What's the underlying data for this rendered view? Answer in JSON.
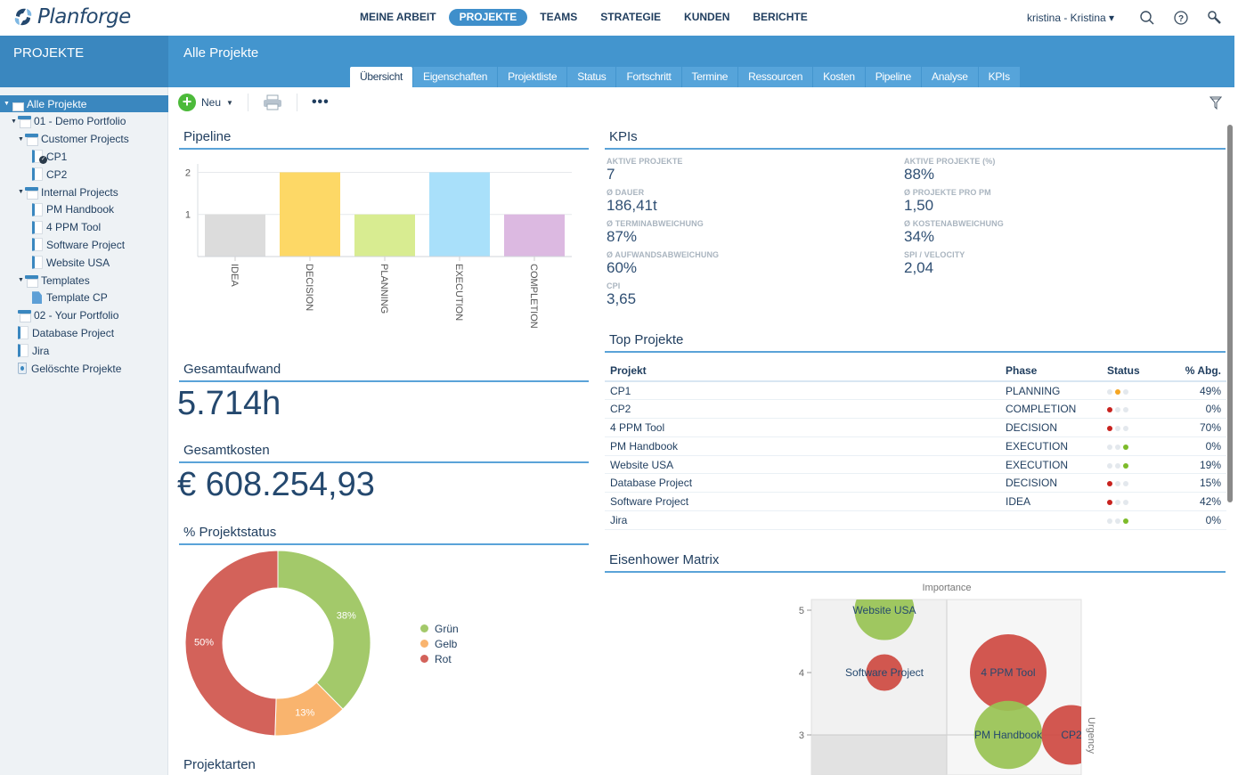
{
  "app": {
    "brand": "Planforge"
  },
  "nav": {
    "items": [
      "MEINE ARBEIT",
      "PROJEKTE",
      "TEAMS",
      "STRATEGIE",
      "KUNDEN",
      "BERICHTE"
    ],
    "active": "PROJEKTE",
    "user": "kristina - Kristina ▾"
  },
  "module_title": "PROJEKTE",
  "page_title": "Alle Projekte",
  "tabs": [
    "Übersicht",
    "Eigenschaften",
    "Projektliste",
    "Status",
    "Fortschritt",
    "Termine",
    "Ressourcen",
    "Kosten",
    "Pipeline",
    "Analyse",
    "KPIs"
  ],
  "active_tab": "Übersicht",
  "toolbar": {
    "new_label": "Neu",
    "more_label": "•••"
  },
  "tree": [
    {
      "label": "Alle Projekte",
      "level": 0,
      "icon": "folder",
      "caret": true,
      "selected": true
    },
    {
      "label": "01 - Demo Portfolio",
      "level": 1,
      "icon": "folder",
      "caret": true
    },
    {
      "label": "Customer Projects",
      "level": 2,
      "icon": "folder",
      "caret": true
    },
    {
      "label": "CP1",
      "level": 3,
      "icon": "project-checked"
    },
    {
      "label": "CP2",
      "level": 3,
      "icon": "project"
    },
    {
      "label": "Internal Projects",
      "level": 2,
      "icon": "folder",
      "caret": true
    },
    {
      "label": "PM Handbook",
      "level": 3,
      "icon": "project"
    },
    {
      "label": "4 PPM Tool",
      "level": 3,
      "icon": "project"
    },
    {
      "label": "Software Project",
      "level": 3,
      "icon": "project"
    },
    {
      "label": "Website USA",
      "level": 3,
      "icon": "project"
    },
    {
      "label": "Templates",
      "level": 2,
      "icon": "folder",
      "caret": true
    },
    {
      "label": "Template CP",
      "level": 3,
      "icon": "template"
    },
    {
      "label": "02 - Your Portfolio",
      "level": 1,
      "icon": "folder"
    },
    {
      "label": "Database Project",
      "level": 1,
      "icon": "project"
    },
    {
      "label": "Jira",
      "level": 1,
      "icon": "project"
    },
    {
      "label": "Gelöschte Projekte",
      "level": 1,
      "icon": "trash"
    }
  ],
  "sections": {
    "pipeline": "Pipeline",
    "kpis": "KPIs",
    "gesamtaufwand": "Gesamtaufwand",
    "gesamtaufwand_value": "5.714h",
    "gesamtkosten": "Gesamtkosten",
    "gesamtkosten_value": "€ 608.254,93",
    "projektstatus": "% Projektstatus",
    "projektarten": "Projektarten",
    "top_projekte": "Top Projekte",
    "eisenhower": "Eisenhower Matrix"
  },
  "kpis": [
    {
      "label": "AKTIVE PROJEKTE",
      "value": "7"
    },
    {
      "label": "AKTIVE PROJEKTE (%)",
      "value": "88%"
    },
    {
      "label": "Ø DAUER",
      "value": "186,41t"
    },
    {
      "label": "Ø PROJEKTE PRO PM",
      "value": "1,50"
    },
    {
      "label": "Ø TERMINABWEICHUNG",
      "value": "87%"
    },
    {
      "label": "Ø KOSTENABWEICHUNG",
      "value": "34%"
    },
    {
      "label": "Ø AUFWANDSABWEICHUNG",
      "value": "60%"
    },
    {
      "label": "SPI / VELOCITY",
      "value": "2,04"
    },
    {
      "label": "CPI",
      "value": "3,65"
    }
  ],
  "top_projects": {
    "columns": [
      "Projekt",
      "Phase",
      "Status",
      "% Abg."
    ],
    "rows": [
      {
        "project": "CP1",
        "phase": "PLANNING",
        "status": "yellow",
        "pct": "49%"
      },
      {
        "project": "CP2",
        "phase": "COMPLETION",
        "status": "red",
        "pct": "0%"
      },
      {
        "project": "4 PPM Tool",
        "phase": "DECISION",
        "status": "red",
        "pct": "70%"
      },
      {
        "project": "PM Handbook",
        "phase": "EXECUTION",
        "status": "green",
        "pct": "0%"
      },
      {
        "project": "Website USA",
        "phase": "EXECUTION",
        "status": "green",
        "pct": "19%"
      },
      {
        "project": "Database Project",
        "phase": "DECISION",
        "status": "red",
        "pct": "15%"
      },
      {
        "project": "Software Project",
        "phase": "IDEA",
        "status": "red",
        "pct": "42%"
      },
      {
        "project": "Jira",
        "phase": "",
        "status": "green",
        "pct": "0%"
      }
    ]
  },
  "status_colors": {
    "red": "#c8221e",
    "yellow": "#f5a623",
    "green": "#7dbb2a",
    "off": "#e3e8ed"
  },
  "chart_data": [
    {
      "type": "bar",
      "title": "Pipeline",
      "categories": [
        "IDEA",
        "DECISION",
        "PLANNING",
        "EXECUTION",
        "COMPLETION"
      ],
      "values": [
        1,
        2,
        1,
        2,
        1
      ],
      "colors": [
        "#dcdcdc",
        "#fdd866",
        "#d8ec91",
        "#a9e0fa",
        "#dcb9e1"
      ],
      "yticks": [
        1,
        2
      ],
      "ylim": [
        0,
        2.2
      ],
      "xlabel": "",
      "ylabel": "",
      "grid": true
    },
    {
      "type": "pie",
      "title": "% Projektstatus",
      "donut": true,
      "slices": [
        {
          "label": "Grün",
          "value": 38,
          "display": "38%",
          "color": "#a3c96a"
        },
        {
          "label": "Gelb",
          "value": 13,
          "display": "13%",
          "color": "#f9b46e"
        },
        {
          "label": "Rot",
          "value": 50,
          "display": "50%",
          "color": "#d3625a"
        }
      ],
      "legend": "right"
    },
    {
      "type": "scatter",
      "title": "Eisenhower Matrix",
      "xlabel": "Importance",
      "ylabel": "Urgency",
      "yticks": [
        3,
        4,
        5
      ],
      "points": [
        {
          "label": "Website USA",
          "x": 2,
          "y": 5,
          "size": 2,
          "color": "green"
        },
        {
          "label": "Software Project",
          "x": 2,
          "y": 4,
          "size": 1,
          "color": "red"
        },
        {
          "label": "4 PPM Tool",
          "x": 4,
          "y": 4,
          "size": 3,
          "color": "red"
        },
        {
          "label": "PM Handbook",
          "x": 4,
          "y": 3,
          "size": 2.5,
          "color": "green"
        },
        {
          "label": "CP2",
          "x": 5,
          "y": 3,
          "size": 2,
          "color": "red"
        }
      ],
      "point_colors": {
        "green": "#99c454",
        "red": "#cf4a42"
      }
    }
  ]
}
